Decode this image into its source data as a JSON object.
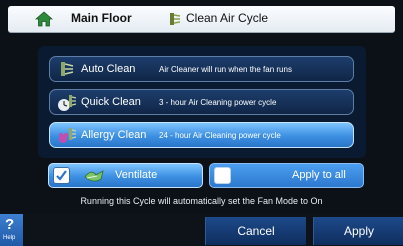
{
  "header": {
    "title": "Main Floor",
    "subtitle": "Clean Air Cycle",
    "home_icon": "home-icon",
    "cycle_icon": "air-filter-icon"
  },
  "options": [
    {
      "name": "Auto Clean",
      "description": "Air Cleaner will run when the fan runs",
      "icon": "air-filter-icon",
      "selected": false
    },
    {
      "name": "Quick Clean",
      "description": "3 - hour Air Cleaning power cycle",
      "icon": "quick-clean-icon",
      "selected": false
    },
    {
      "name": "Allergy Clean",
      "description": "24 - hour Air Cleaning power cycle",
      "icon": "allergy-clean-icon",
      "selected": true
    }
  ],
  "ventilate": {
    "label": "Ventilate",
    "checked": true
  },
  "apply_all": {
    "label": "Apply to all",
    "checked": false
  },
  "note": "Running this Cycle will automatically set the Fan Mode to On",
  "footer": {
    "help_symbol": "?",
    "help_label": "Help",
    "cancel_label": "Cancel",
    "apply_label": "Apply"
  },
  "colors": {
    "accent": "#3c8fe2",
    "panel": "#0a1a30",
    "header": "#eef2f7"
  }
}
